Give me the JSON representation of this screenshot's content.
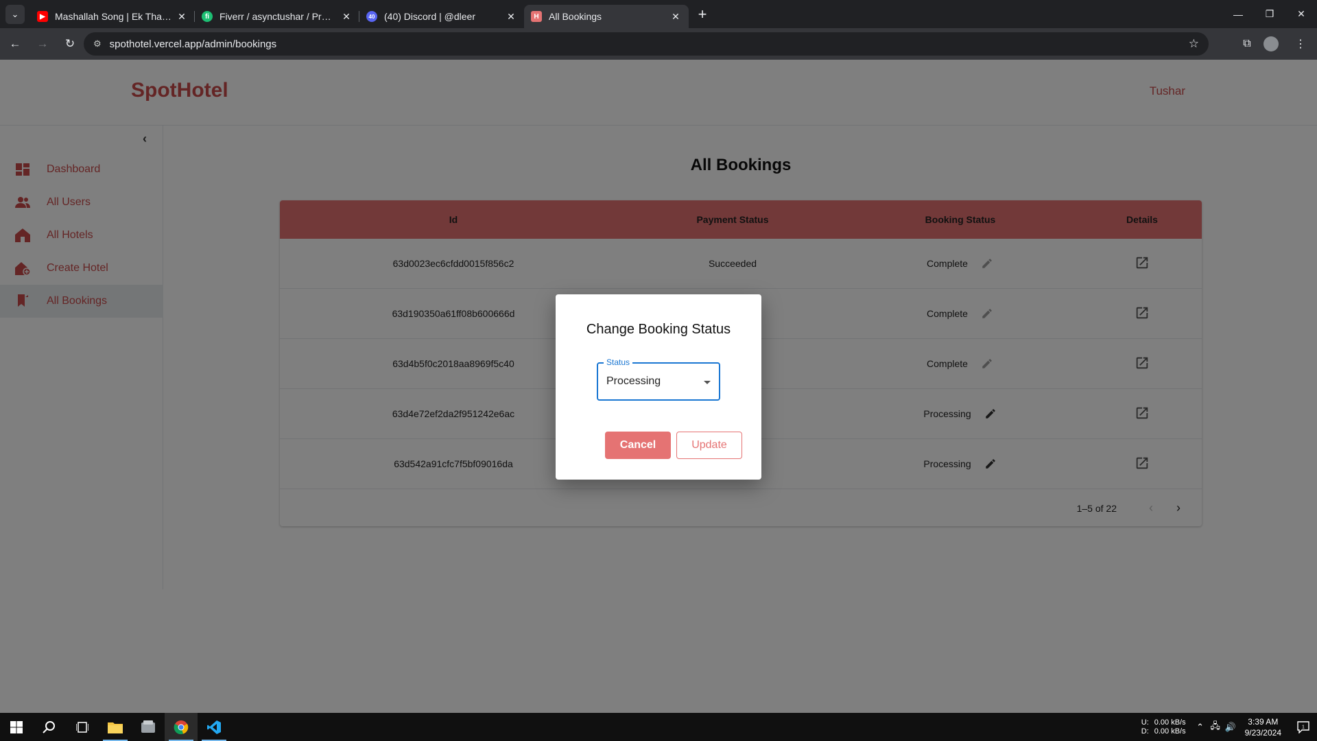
{
  "browser": {
    "tabs": [
      {
        "title": "Mashallah Song | Ek Tha Tiger |",
        "favicon": "youtube-icon",
        "color": "#ff0000"
      },
      {
        "title": "Fiverr / asynctushar / Promoted",
        "favicon": "fiverr-icon",
        "color": "#1dbf73"
      },
      {
        "title": "(40) Discord | @dleer",
        "favicon": "discord-icon",
        "color": "#5865f2",
        "badge": "40"
      },
      {
        "title": "All Bookings",
        "favicon": "spothotel-icon",
        "color": "#e57373",
        "active": true
      }
    ],
    "url": "spothotel.vercel.app/admin/bookings"
  },
  "app": {
    "brand": "SpotHotel",
    "user": "Tushar",
    "accent": "#c94a4a"
  },
  "sidebar": {
    "items": [
      {
        "label": "Dashboard",
        "icon": "dashboard-icon"
      },
      {
        "label": "All Users",
        "icon": "users-icon"
      },
      {
        "label": "All Hotels",
        "icon": "hotel-icon"
      },
      {
        "label": "Create Hotel",
        "icon": "add-hotel-icon"
      },
      {
        "label": "All Bookings",
        "icon": "bookmark-icon",
        "active": true
      }
    ]
  },
  "page": {
    "title": "All Bookings"
  },
  "table": {
    "headers": [
      "Id",
      "Payment Status",
      "Booking Status",
      "Details"
    ],
    "rows": [
      {
        "id": "63d0023ec6cfdd0015f856c2",
        "payment": "Succeeded",
        "status": "Complete"
      },
      {
        "id": "63d190350a61ff08b600666d",
        "payment": "",
        "status": "Complete"
      },
      {
        "id": "63d4b5f0c2018aa8969f5c40",
        "payment": "",
        "status": "Complete"
      },
      {
        "id": "63d4e72ef2da2f951242e6ac",
        "payment": "",
        "status": "Processing"
      },
      {
        "id": "63d542a91cfc7f5bf09016da",
        "payment": "",
        "status": "Processing"
      }
    ],
    "pagination": "1–5 of 22"
  },
  "dialog": {
    "title": "Change Booking Status",
    "select_label": "Status",
    "select_value": "Processing",
    "cancel": "Cancel",
    "update": "Update"
  },
  "taskbar": {
    "net_up_label": "U:",
    "net_down_label": "D:",
    "net_up": "0.00 kB/s",
    "net_down": "0.00 kB/s",
    "time": "3:39 AM",
    "date": "9/23/2024",
    "notif_count": "1"
  }
}
